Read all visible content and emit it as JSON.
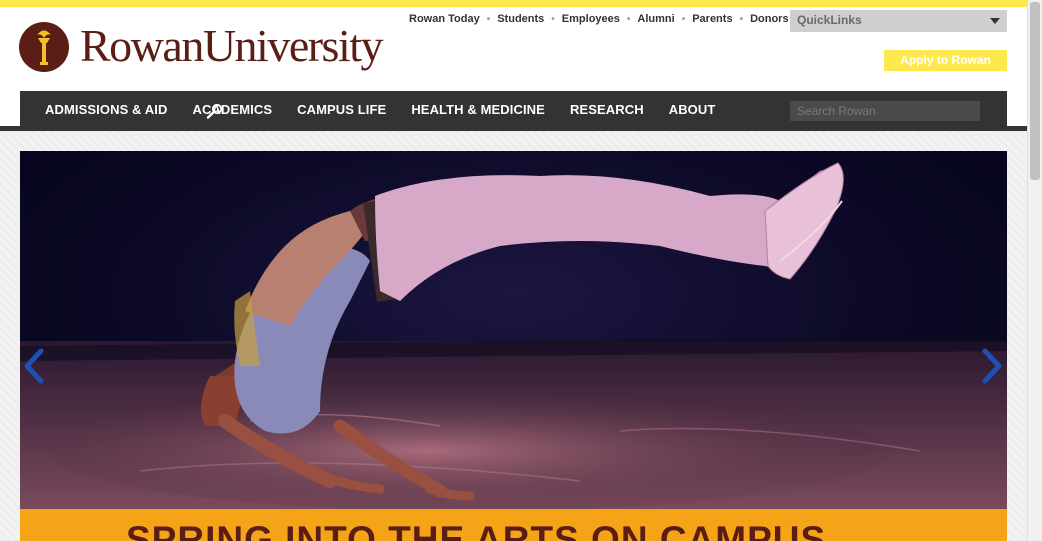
{
  "brand": {
    "name": "RowanUniversity"
  },
  "utility_nav": {
    "items": [
      {
        "label": "Rowan Today"
      },
      {
        "label": "Students"
      },
      {
        "label": "Employees"
      },
      {
        "label": "Alumni"
      },
      {
        "label": "Parents"
      },
      {
        "label": "Donors"
      }
    ],
    "separator": "•"
  },
  "quicklinks": {
    "label": "QuickLinks"
  },
  "apply": {
    "label": "Apply to Rowan"
  },
  "main_nav": {
    "items": [
      {
        "label": "ADMISSIONS & AID"
      },
      {
        "label": "ACADEMICS"
      },
      {
        "label": "CAMPUS LIFE"
      },
      {
        "label": "HEALTH & MEDICINE"
      },
      {
        "label": "RESEARCH"
      },
      {
        "label": "ABOUT"
      }
    ]
  },
  "search": {
    "placeholder": "Search Rowan",
    "value": ""
  },
  "hero": {
    "caption": "SPRING INTO THE ARTS ON CAMPUS"
  },
  "colors": {
    "brand_maroon": "#5a1e16",
    "gold": "#fde94e",
    "nav_bg": "#333333",
    "caption_orange": "#f5a417",
    "arrow_blue": "#1f4fb3"
  },
  "icons": {
    "seal": "torch-seal-icon",
    "dropdown": "chevron-down-icon",
    "search": "magnifier-icon",
    "prev": "chevron-left-icon",
    "next": "chevron-right-icon"
  }
}
